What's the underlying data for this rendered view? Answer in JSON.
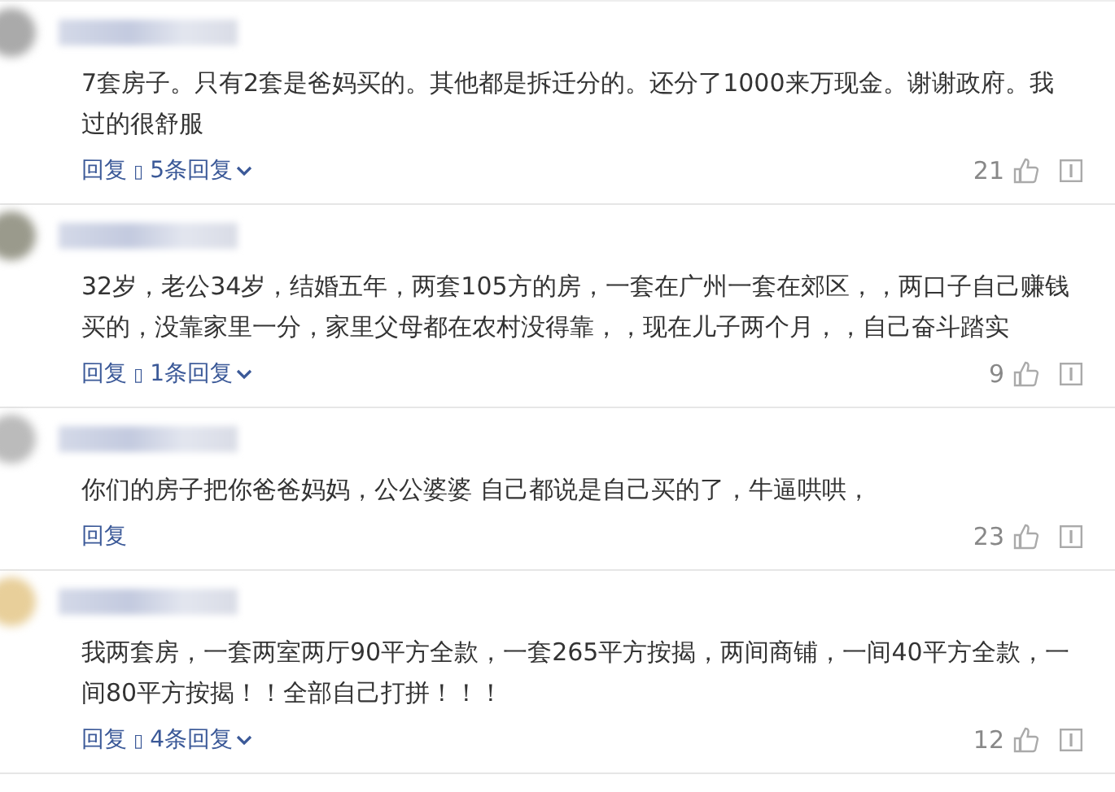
{
  "comments": [
    {
      "text": "7套房子。只有2套是爸妈买的。其他都是拆迁分的。还分了1000来万现金。谢谢政府。我过的很舒服",
      "reply": "回复",
      "separator": "▯",
      "replies": "5条回复",
      "likes": "21"
    },
    {
      "text": "32岁，老公34岁，结婚五年，两套105方的房，一套在广州一套在郊区，，两口子自己赚钱买的，没靠家里一分，家里父母都在农村没得靠，，现在儿子两个月，，自己奋斗踏实",
      "reply": "回复",
      "separator": "▯",
      "replies": "1条回复",
      "likes": "9"
    },
    {
      "text": "你们的房子把你爸爸妈妈，公公婆婆 自己都说是自己买的了，牛逼哄哄，",
      "reply": "回复",
      "likes": "23"
    },
    {
      "text": "我两套房，一套两室两厅90平方全款，一套265平方按揭，两间商铺，一间40平方全款，一间80平方按揭！！全部自己打拼！！！",
      "reply": "回复",
      "separator": "▯",
      "replies": "4条回复",
      "likes": "12"
    }
  ]
}
